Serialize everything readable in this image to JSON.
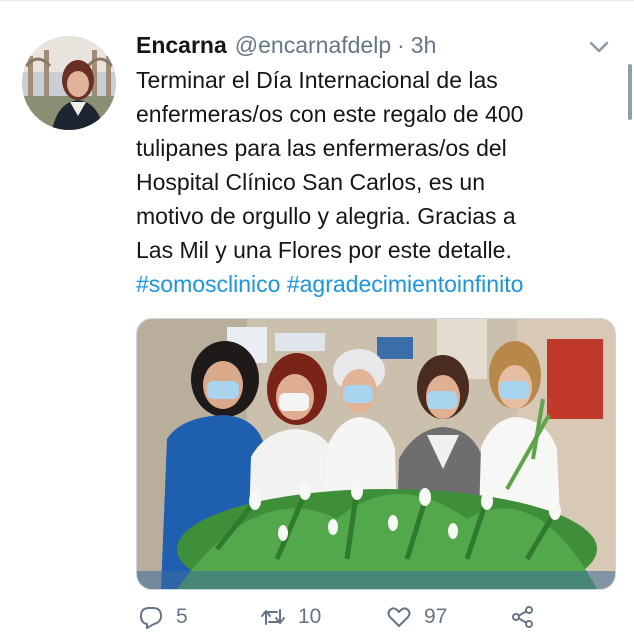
{
  "tweet": {
    "author_name": "Encarna",
    "handle": "@encarnafdelp",
    "separator": "·",
    "time": "3h",
    "text_lines": [
      "Terminar el Día Internacional de las",
      "enfermeras/os con este regalo de 400",
      "tulipanes para las enfermeras/os del",
      "Hospital Clínico San Carlos, es un",
      "motivo de orgullo y alegria. Gracias a",
      "Las Mil y una Flores por este detalle."
    ],
    "hashtags": [
      "#somosclinico",
      "#agradecimientoinfinito"
    ]
  },
  "actions": {
    "replies": "5",
    "retweets": "10",
    "likes": "97"
  },
  "colors": {
    "link": "#1b95e0",
    "muted": "#657786",
    "text": "#14171a"
  },
  "icons": {
    "menu": "chevron-down-icon",
    "reply": "reply-icon",
    "retweet": "retweet-icon",
    "like": "heart-icon",
    "share": "share-icon"
  }
}
